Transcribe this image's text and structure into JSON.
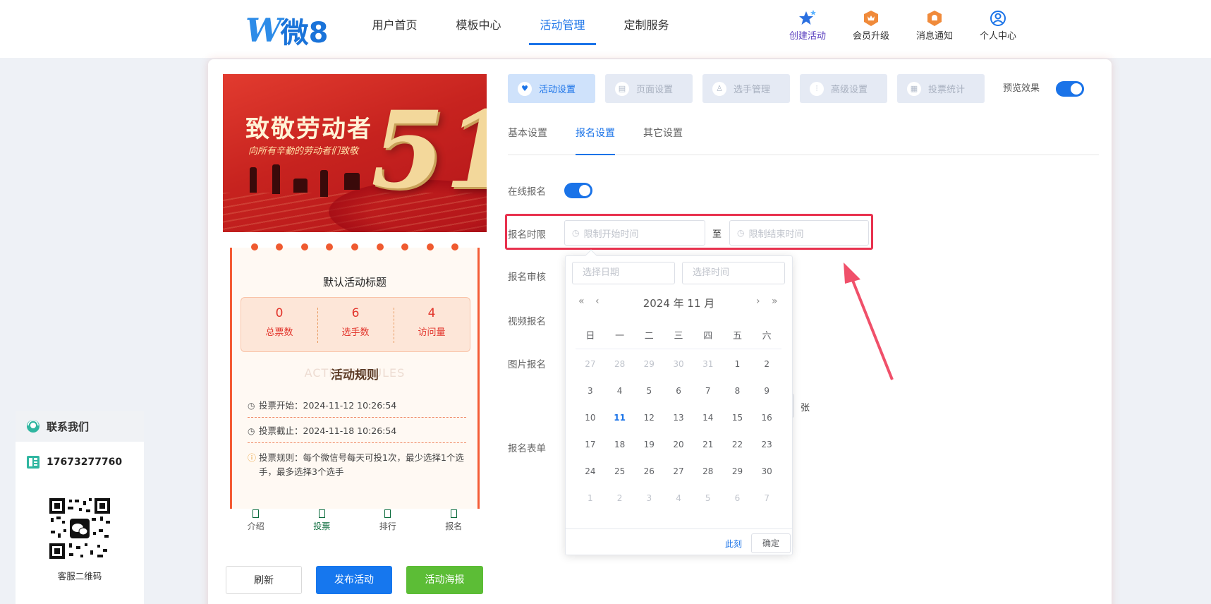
{
  "header": {
    "logo": "W微8",
    "nav": [
      "用户首页",
      "模板中心",
      "活动管理",
      "定制服务"
    ],
    "actions": [
      "创建活动",
      "会员升级",
      "消息通知",
      "个人中心"
    ]
  },
  "preview": {
    "banner_title": "致敬劳动者",
    "banner_sub": "向所有辛勤的劳动者们致敬",
    "banner_big": "51",
    "activity_title": "默认活动标题",
    "stats": [
      {
        "value": "0",
        "label": "总票数"
      },
      {
        "value": "6",
        "label": "选手数"
      },
      {
        "value": "4",
        "label": "访问量"
      }
    ],
    "rules_bg": "ACTIVITY RULES",
    "rules_title": "活动规则",
    "vote_start": "投票开始：2024-11-12 10:26:54",
    "vote_end": "投票截止：2024-11-18 10:26:54",
    "vote_rule": "投票规则：每个微信号每天可投1次，最少选择1个选手，最多选择3个选手",
    "tabs": [
      "介绍",
      "投票",
      "排行",
      "报名"
    ]
  },
  "buttons": {
    "refresh": "刷新",
    "publish": "发布活动",
    "poster": "活动海报"
  },
  "settings": {
    "tabs": [
      "活动设置",
      "页面设置",
      "选手管理",
      "高级设置",
      "投票统计"
    ],
    "preview_label": "预览效果",
    "sub_tabs": [
      "基本设置",
      "报名设置",
      "其它设置"
    ],
    "labels": {
      "online": "在线报名",
      "time_limit": "报名时限",
      "review": "报名审核",
      "video": "视频报名",
      "image": "图片报名",
      "form": "报名表单"
    },
    "start_placeholder": "限制开始时间",
    "end_placeholder": "限制结束时间",
    "to": "至",
    "unit": "张"
  },
  "calendar": {
    "date_placeholder": "选择日期",
    "time_placeholder": "选择时间",
    "year_month": "2024 年  11 月",
    "weekdays": [
      "日",
      "一",
      "二",
      "三",
      "四",
      "五",
      "六"
    ],
    "rows": [
      [
        "27",
        "28",
        "29",
        "30",
        "31",
        "1",
        "2"
      ],
      [
        "3",
        "4",
        "5",
        "6",
        "7",
        "8",
        "9"
      ],
      [
        "10",
        "11",
        "12",
        "13",
        "14",
        "15",
        "16"
      ],
      [
        "17",
        "18",
        "19",
        "20",
        "21",
        "22",
        "23"
      ],
      [
        "24",
        "25",
        "26",
        "27",
        "28",
        "29",
        "30"
      ],
      [
        "1",
        "2",
        "3",
        "4",
        "5",
        "6",
        "7"
      ]
    ],
    "now": "此刻",
    "ok": "确定"
  },
  "contact": {
    "title": "联系我们",
    "phone": "17673277760",
    "qr_label": "客服二维码"
  },
  "colors": {
    "accent": "#1a73e8",
    "highlight": "#e8324e",
    "banner": "#c7231f",
    "green": "#5cbd36"
  }
}
